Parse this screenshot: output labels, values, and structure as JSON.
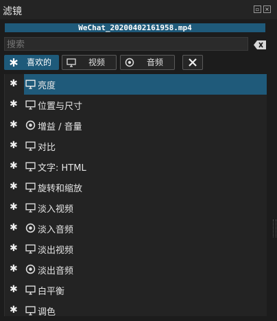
{
  "window": {
    "title": "滤镜"
  },
  "file": {
    "name": "WeChat_20200402161958.mp4"
  },
  "search": {
    "placeholder": "搜索"
  },
  "tabs": [
    {
      "label": "喜欢的",
      "icon": "star-icon",
      "active": true
    },
    {
      "label": "视频",
      "icon": "monitor-icon",
      "active": false
    },
    {
      "label": "音频",
      "icon": "audio-disc-icon",
      "active": false
    }
  ],
  "filters": [
    {
      "label": "亮度",
      "icon": "monitor-icon",
      "selected": true
    },
    {
      "label": "位置与尺寸",
      "icon": "monitor-icon"
    },
    {
      "label": "增益 / 音量",
      "icon": "audio-disc-icon"
    },
    {
      "label": "对比",
      "icon": "monitor-icon"
    },
    {
      "label": "文字: HTML",
      "icon": "monitor-icon"
    },
    {
      "label": "旋转和缩放",
      "icon": "monitor-icon"
    },
    {
      "label": "淡入视频",
      "icon": "monitor-icon"
    },
    {
      "label": "淡入音频",
      "icon": "audio-disc-icon"
    },
    {
      "label": "淡出视频",
      "icon": "monitor-icon"
    },
    {
      "label": "淡出音频",
      "icon": "audio-disc-icon"
    },
    {
      "label": "白平衡",
      "icon": "monitor-icon"
    },
    {
      "label": "调色",
      "icon": "monitor-icon"
    }
  ],
  "colors": {
    "accent": "#1f5a7a",
    "background": "#1c1c1c",
    "list": "#232323"
  }
}
